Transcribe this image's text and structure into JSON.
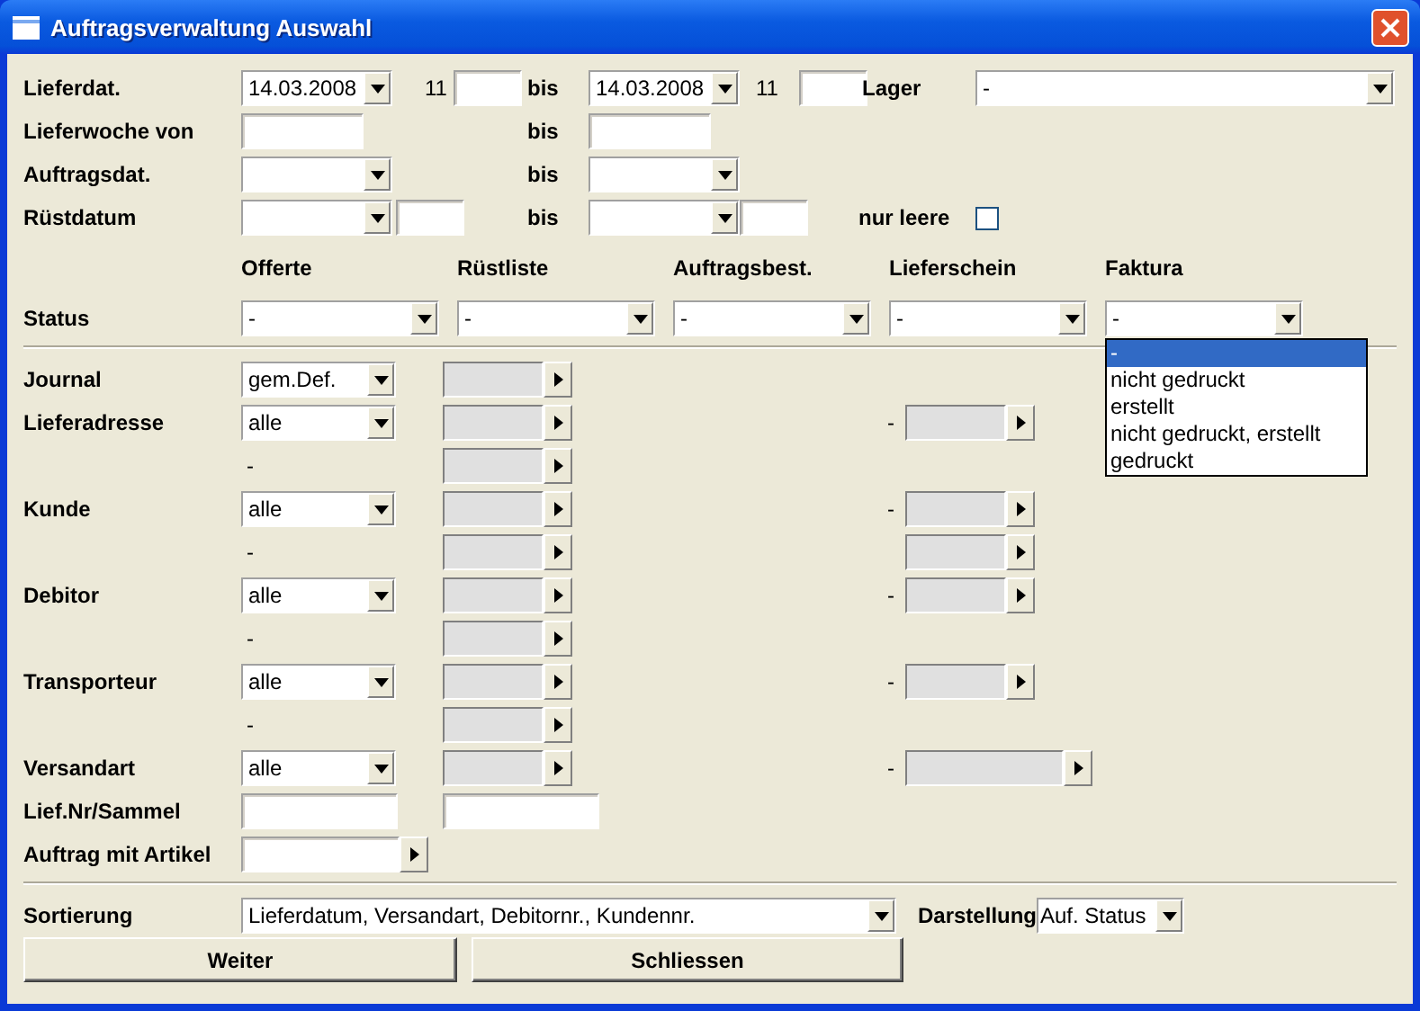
{
  "window": {
    "title": "Auftragsverwaltung Auswahl"
  },
  "dates": {
    "lieferdat": {
      "label": "Lieferdat.",
      "from": "14.03.2008",
      "from_hour": "11",
      "bis": "bis",
      "to": "14.03.2008",
      "to_hour": "11"
    },
    "lager": {
      "label": "Lager",
      "value": "-"
    },
    "lieferwoche": {
      "label": "Lieferwoche von",
      "bis": "bis"
    },
    "auftragsdat": {
      "label": "Auftragsdat.",
      "bis": "bis"
    },
    "ruestdatum": {
      "label": "Rüstdatum",
      "bis": "bis"
    },
    "nur_leere": {
      "label": "nur leere",
      "checked": false
    }
  },
  "status": {
    "label": "Status",
    "columns": [
      {
        "header": "Offerte",
        "value": "-"
      },
      {
        "header": "Rüstliste",
        "value": "-"
      },
      {
        "header": "Auftragsbest.",
        "value": "-"
      },
      {
        "header": "Lieferschein",
        "value": "-"
      },
      {
        "header": "Faktura",
        "value": "-",
        "options": [
          {
            "label": "-",
            "selected": true
          },
          {
            "label": "nicht gedruckt",
            "selected": false
          },
          {
            "label": "erstellt",
            "selected": false
          },
          {
            "label": "nicht gedruckt, erstellt",
            "selected": false
          },
          {
            "label": "gedruckt",
            "selected": false
          }
        ]
      }
    ]
  },
  "filters": [
    {
      "kind": "select",
      "label": "Journal",
      "value": "gem.Def."
    },
    {
      "kind": "select",
      "label": "Lieferadresse",
      "value": "alle",
      "right": {
        "kind": "lookup",
        "dash": "-"
      }
    },
    {
      "kind": "range",
      "dash": "-"
    },
    {
      "kind": "select",
      "label": "Kunde",
      "value": "alle",
      "right": {
        "kind": "lookup",
        "dash": "-"
      }
    },
    {
      "kind": "range",
      "dash": "-",
      "right": {
        "kind": "lookup"
      }
    },
    {
      "kind": "select",
      "label": "Debitor",
      "value": "alle",
      "right": {
        "kind": "lookup",
        "dash": "-"
      }
    },
    {
      "kind": "range",
      "dash": "-"
    },
    {
      "kind": "select",
      "label": "Transporteur",
      "value": "alle",
      "right": {
        "kind": "lookup",
        "dash": "-"
      }
    },
    {
      "kind": "range",
      "dash": "-"
    },
    {
      "kind": "select",
      "label": "Versandart",
      "value": "alle",
      "right": {
        "kind": "wide",
        "dash": "-"
      }
    },
    {
      "kind": "fields",
      "label": "Lief.Nr/Sammel"
    },
    {
      "kind": "article",
      "label": "Auftrag mit Artikel"
    }
  ],
  "sortierung": {
    "label": "Sortierung",
    "value": "Lieferdatum, Versandart, Debitornr., Kundennr."
  },
  "darstellung": {
    "label": "Darstellung",
    "value": "Auf. Status"
  },
  "buttons": [
    "Weiter",
    "Schliessen"
  ]
}
